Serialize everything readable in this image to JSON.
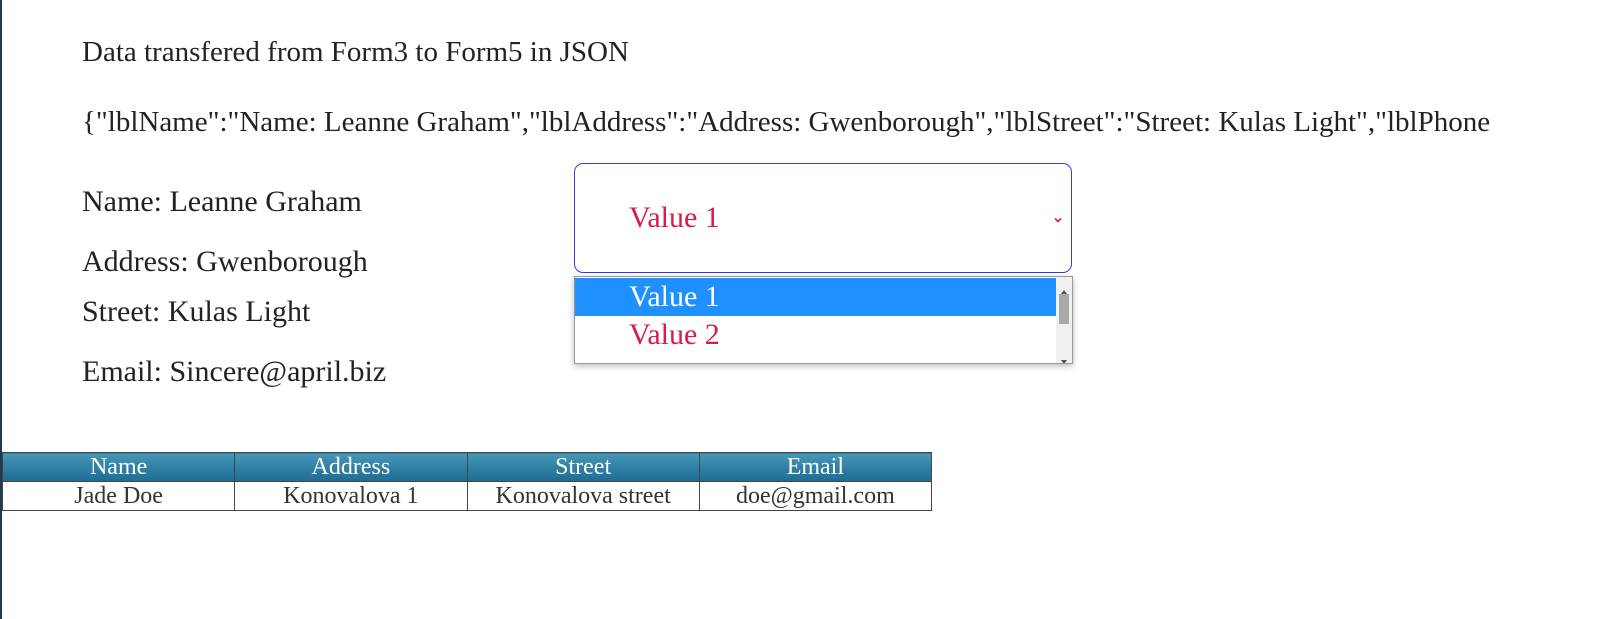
{
  "heading": "Data transfered from Form3 to Form5 in JSON",
  "json_text": "{\"lblName\":\"Name: Leanne Graham\",\"lblAddress\":\"Address: Gwenborough\",\"lblStreet\":\"Street: Kulas Light\",\"lblPhone",
  "fields": {
    "name": "Name: Leanne Graham",
    "address": "Address: Gwenborough",
    "street": "Street: Kulas Light",
    "email": "Email: Sincere@april.biz"
  },
  "select": {
    "selected": "Value 1",
    "options": [
      "Value 1",
      "Value 2"
    ],
    "chevron_icon": "chevron-down-icon",
    "text_color": "#d81b4a",
    "highlight_color": "#1e90ff"
  },
  "table": {
    "headers": [
      "Name",
      "Address",
      "Street",
      "Email"
    ],
    "rows": [
      [
        "Jade Doe",
        "Konovalova 1",
        "Konovalova street",
        "doe@gmail.com"
      ]
    ],
    "header_color": "#2f7ea3"
  }
}
